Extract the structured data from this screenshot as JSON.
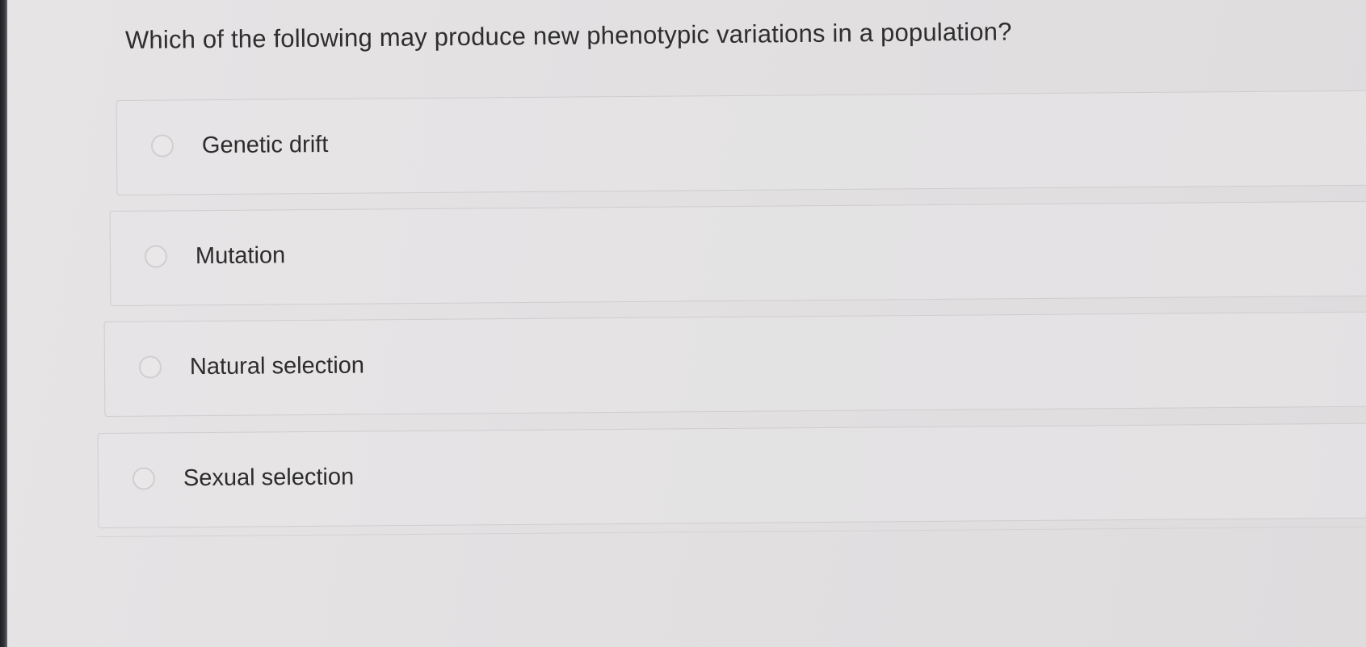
{
  "question": {
    "text": "Which of the following may produce new phenotypic variations in a population?"
  },
  "options": [
    {
      "label": "Genetic drift",
      "selected": false
    },
    {
      "label": "Mutation",
      "selected": false
    },
    {
      "label": "Natural selection",
      "selected": false
    },
    {
      "label": "Sexual selection",
      "selected": false
    }
  ],
  "colors": {
    "background": "#e3e1e2",
    "card_border": "#cfcdce",
    "text": "#2c2c2c",
    "radio_border": "#d0cecf"
  }
}
